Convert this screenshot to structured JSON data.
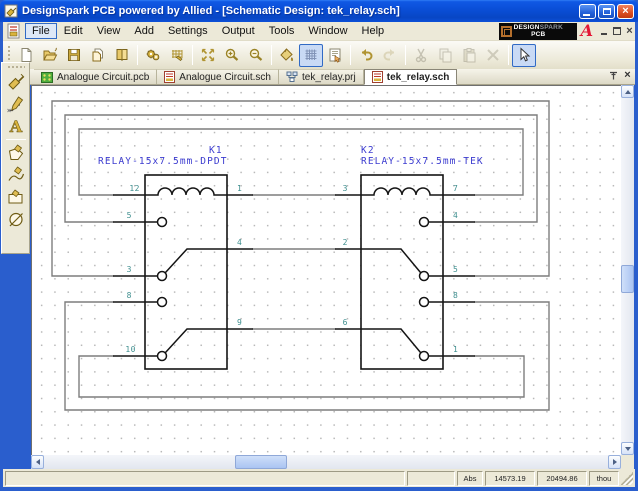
{
  "window": {
    "title": "DesignSpark PCB powered by Allied - [Schematic Design: tek_relay.sch]"
  },
  "brand": {
    "name_top_strong": "DESIGN",
    "name_top_dim": "SPARK",
    "name_bottom": "PCB",
    "allied_mark": "A"
  },
  "menu": {
    "items": [
      "File",
      "Edit",
      "View",
      "Add",
      "Settings",
      "Output",
      "Tools",
      "Window",
      "Help"
    ]
  },
  "toolbar": {
    "icons": [
      "new-document",
      "open",
      "save",
      "save-all",
      "libraries",
      "settings-gears",
      "grid-settings",
      "zoom-extents",
      "zoom-in",
      "zoom-out",
      "color-fill",
      "toggle-grid",
      "design-properties",
      "undo",
      "redo",
      "cut",
      "copy",
      "paste",
      "delete",
      "select-mode"
    ],
    "pressed": [
      "toggle-grid",
      "select-mode"
    ],
    "disabled": [
      "redo",
      "cut",
      "copy",
      "paste",
      "delete"
    ]
  },
  "side_toolbar": {
    "icons": [
      "add-component",
      "add-connection",
      "add-text",
      "add-shape-polygon",
      "add-shape-path",
      "add-shape-rectangle",
      "add-shape-circle"
    ]
  },
  "tabs": [
    {
      "label": "Analogue Circuit.pcb",
      "active": false
    },
    {
      "label": "Analogue Circuit.sch",
      "active": false
    },
    {
      "label": "tek_relay.prj",
      "active": false
    },
    {
      "label": "tek_relay.sch",
      "active": true
    }
  ],
  "schematic": {
    "k1": {
      "ref": "K1",
      "name": "RELAY-15x7.5mm-DPDT",
      "pin12": "12",
      "pin5": "5",
      "pin3": "3",
      "pin8": "8",
      "pin10": "10",
      "pin1": "1",
      "pin4": "4",
      "pin9": "9"
    },
    "k2": {
      "ref": "K2",
      "name": "RELAY-15x7.5mm-TEK",
      "pin3": "3",
      "pin2": "2",
      "pin6": "6",
      "pin7": "7",
      "pin4": "4",
      "pin5": "5",
      "pin8": "8",
      "pin1": "1"
    }
  },
  "status_bar": {
    "mode": "Abs",
    "x": "14573.19",
    "y": "20494.86",
    "units": "thou"
  },
  "colors": {
    "accent": "#316AC5",
    "net": "#7d7d7d",
    "component": "#141414",
    "pin_label": "#3f8f8f",
    "ref_label": "#3c3cd0",
    "allied_red": "#E31837"
  }
}
